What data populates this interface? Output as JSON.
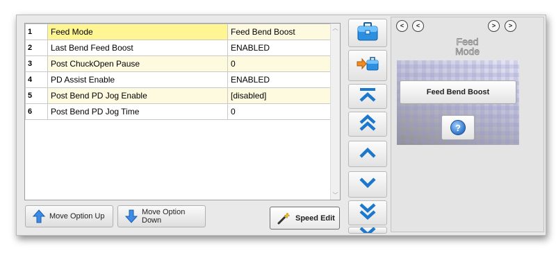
{
  "options": [
    {
      "num": "1",
      "name": "Feed Mode",
      "value": "Feed Bend Boost"
    },
    {
      "num": "2",
      "name": "Last Bend Feed Boost",
      "value": "ENABLED"
    },
    {
      "num": "3",
      "name": "Post ChuckOpen Pause",
      "value": "0"
    },
    {
      "num": "4",
      "name": "PD Assist Enable",
      "value": "ENABLED"
    },
    {
      "num": "5",
      "name": "Post Bend PD Jog Enable",
      "value": "[disabled]"
    },
    {
      "num": "6",
      "name": "Post Bend PD Jog Time",
      "value": "0"
    }
  ],
  "buttons": {
    "move_up": "Move Option Up",
    "move_down": "Move Option Down",
    "speed_edit": "Speed Edit"
  },
  "right_panel": {
    "title_line1": "Feed",
    "title_line2": "Mode",
    "value_button": "Feed Bend Boost",
    "help_label": "?",
    "nav_glyphs": [
      "<",
      "<",
      ">",
      ">"
    ]
  },
  "colors": {
    "selected_row": "#fff693",
    "alt_row": "#fdfadf",
    "nav_arrow": "#1b78cc"
  },
  "selected_option": 1,
  "scroll_arrows": {
    "up": "︿",
    "down": "﹀"
  }
}
